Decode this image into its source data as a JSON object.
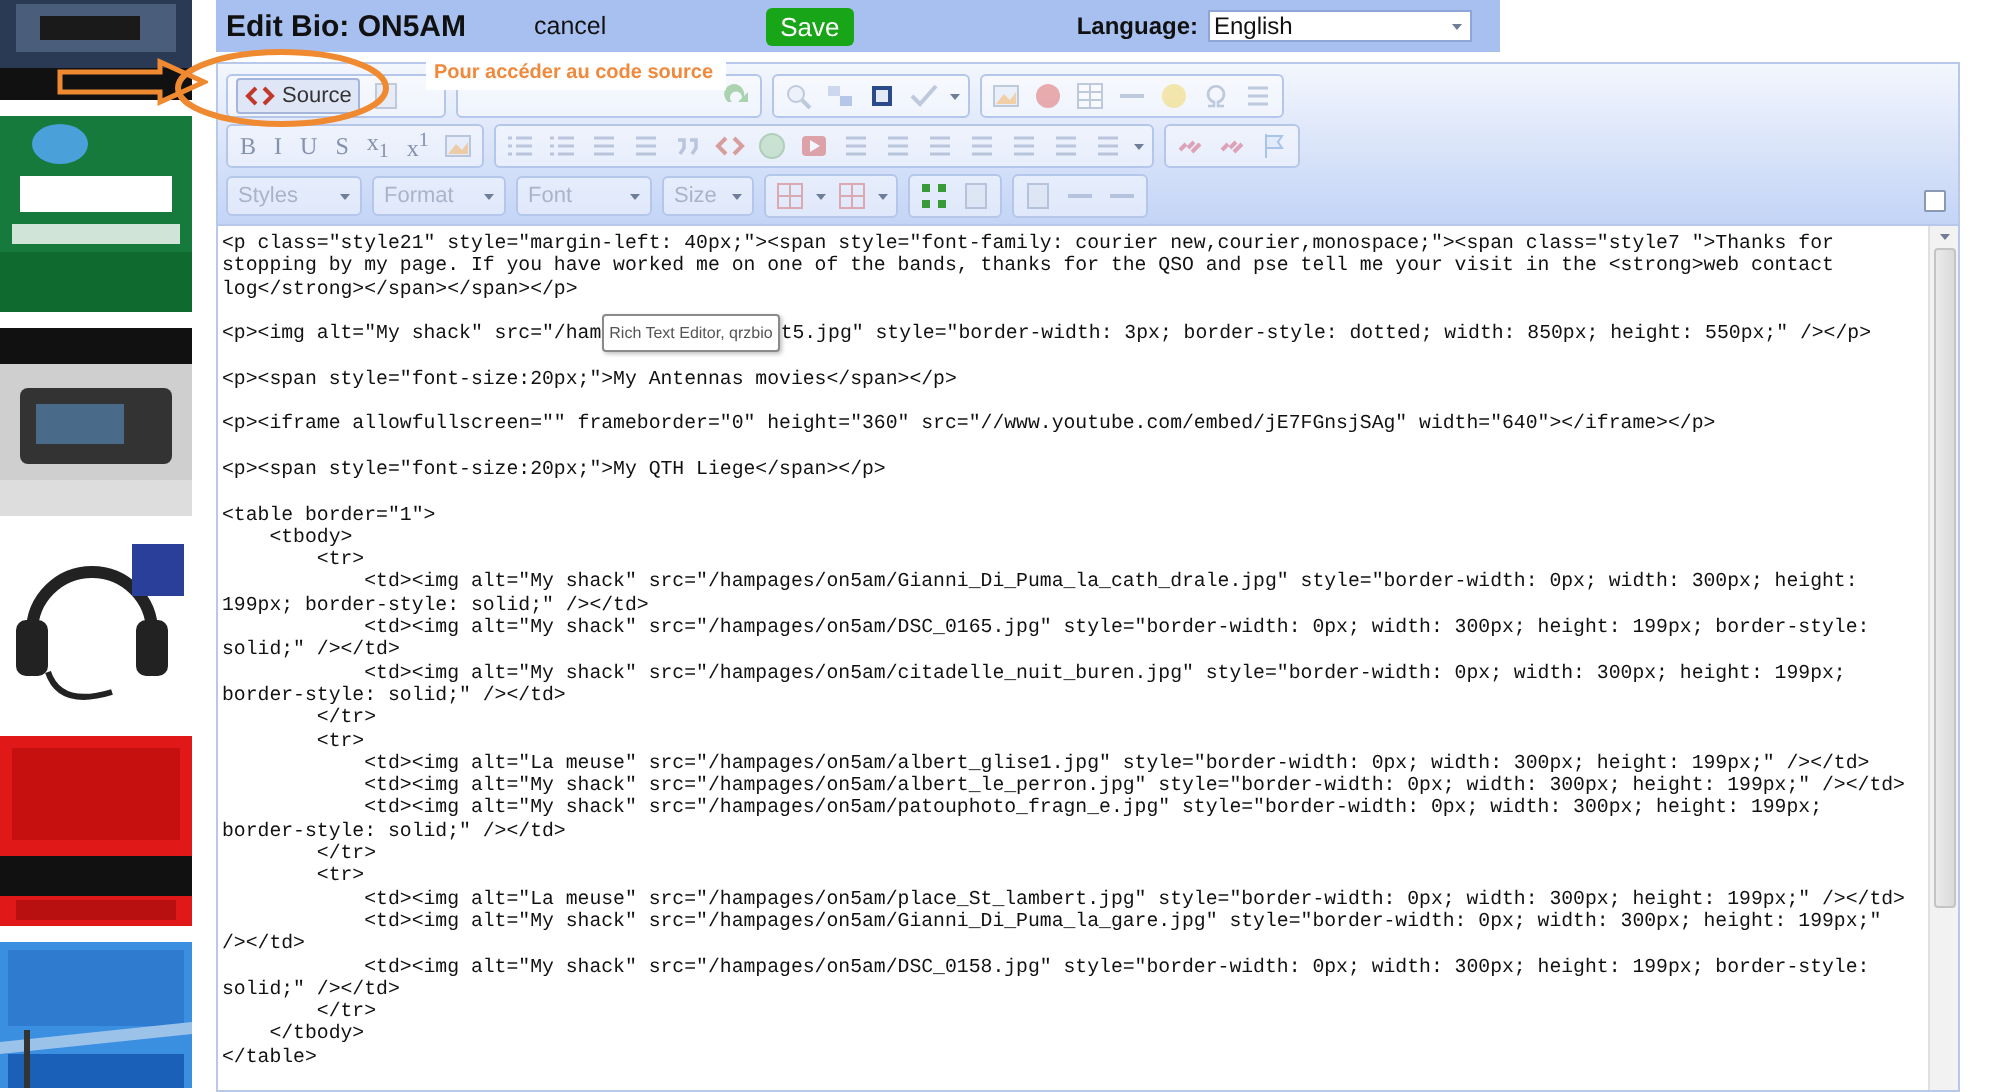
{
  "header": {
    "title": "Edit Bio: ON5AM",
    "cancel": "cancel",
    "save": "Save",
    "language_label": "Language:",
    "language": "English"
  },
  "annotation": {
    "label": "Pour accéder au code source"
  },
  "toolbar": {
    "source_button": {
      "label": "Source",
      "selected": true
    },
    "format_buttons": [
      {
        "label": "B",
        "disabled": true
      },
      {
        "label": "I",
        "disabled": true
      },
      {
        "label": "U",
        "disabled": true
      },
      {
        "label": "S",
        "disabled": true
      },
      {
        "label": "x$_{1}$",
        "disabled": true
      },
      {
        "label": "x$^{1}$",
        "disabled": true
      }
    ],
    "dropdowns": [
      {
        "label": "Styles",
        "disabled": true
      },
      {
        "label": "Format",
        "disabled": true
      },
      {
        "label": "Font",
        "disabled": true
      },
      {
        "label": "Size",
        "disabled": true
      }
    ]
  },
  "code_blocks": [
    {
      "kind": "plain",
      "lines": [
        "<p class=\"style21\" style=\"margin-left: 40px;\"><span style=\"font-family: courier new,courier,monospace;\"><span class=\"style7 \">Thanks for",
        "stopping by my page. If you have worked me on one of the bands, thanks for the QSO and pse tell me your visit in the <strong>web contact",
        "log</strong></span></span></p>"
      ]
    },
    {
      "kind": "covered",
      "before": "<p><img alt=\"My shack\" src=\"/ham",
      "tooltip": "Rich Text Editor, qrzbio",
      "after": "t5.jpg\" style=\"border-width: 3px; border-style: dotted; width: 850px; height: 550px;\" /></p>"
    },
    {
      "kind": "plain",
      "lines": [
        "<p><span style=\"font-size:20px;\">My Antennas movies</span></p>"
      ]
    },
    {
      "kind": "plain",
      "lines": [
        "<p><iframe allowfullscreen=\"\" frameborder=\"0\" height=\"360\" src=\"//www.youtube.com/embed/jE7FGnsjSAg\" width=\"640\"></iframe></p>"
      ]
    },
    {
      "kind": "plain",
      "lines": [
        "<p><span style=\"font-size:20px;\">My QTH Liege</span></p>"
      ]
    },
    {
      "kind": "plain",
      "lines": [
        "<table border=\"1\">",
        "    <tbody>",
        "        <tr>",
        "            <td><img alt=\"My shack\" src=\"/hampages/on5am/Gianni_Di_Puma_la_cath_drale.jpg\" style=\"border-width: 0px; width: 300px; height:",
        "199px; border-style: solid;\" /></td>",
        "            <td><img alt=\"My shack\" src=\"/hampages/on5am/DSC_0165.jpg\" style=\"border-width: 0px; width: 300px; height: 199px; border-style:",
        "solid;\" /></td>",
        "            <td><img alt=\"My shack\" src=\"/hampages/on5am/citadelle_nuit_buren.jpg\" style=\"border-width: 0px; width: 300px; height: 199px;",
        "border-style: solid;\" /></td>",
        "        </tr>",
        "        <tr>",
        "            <td><img alt=\"La meuse\" src=\"/hampages/on5am/albert_glise1.jpg\" style=\"border-width: 0px; width: 300px; height: 199px;\" /></td>",
        "            <td><img alt=\"My shack\" src=\"/hampages/on5am/albert_le_perron.jpg\" style=\"border-width: 0px; width: 300px; height: 199px;\" /></td>",
        "            <td><img alt=\"My shack\" src=\"/hampages/on5am/patouphoto_fragn_e.jpg\" style=\"border-width: 0px; width: 300px; height: 199px;",
        "border-style: solid;\" /></td>",
        "        </tr>",
        "        <tr>",
        "            <td><img alt=\"La meuse\" src=\"/hampages/on5am/place_St_lambert.jpg\" style=\"border-width: 0px; width: 300px; height: 199px;\" /></td>",
        "            <td><img alt=\"My shack\" src=\"/hampages/on5am/Gianni_Di_Puma_la_gare.jpg\" style=\"border-width: 0px; width: 300px; height: 199px;\"",
        "/></td>",
        "            <td><img alt=\"My shack\" src=\"/hampages/on5am/DSC_0158.jpg\" style=\"border-width: 0px; width: 300px; height: 199px; border-style:",
        "solid;\" /></td>",
        "        </tr>",
        "    </tbody>",
        "</table>"
      ]
    }
  ]
}
